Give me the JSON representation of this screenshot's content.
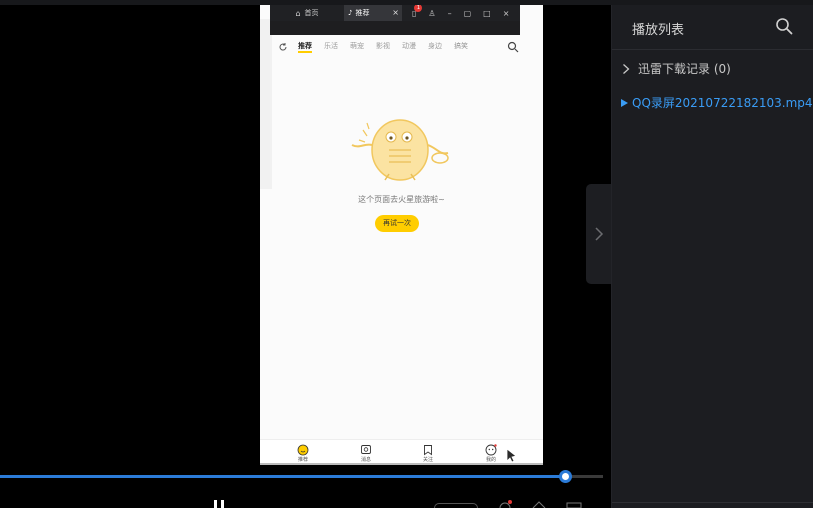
{
  "recording": {
    "browser_tabs": [
      {
        "label": "首页"
      },
      {
        "label": "推荐"
      }
    ],
    "tab_badge_count": "1",
    "nav_items": [
      "推荐",
      "乐活",
      "萌宠",
      "影视",
      "动漫",
      "身边",
      "搞笑"
    ],
    "empty_message": "这个页面去火星旅游啦~",
    "retry_label": "再试一次",
    "bottom_nav": [
      "推荐",
      "消息",
      "关注",
      "我的"
    ]
  },
  "progress": {
    "fraction": 0.937
  },
  "playlist": {
    "title": "播放列表",
    "folder_label": "迅雷下载记录 (0)",
    "playing_file": "QQ录屏20210722182103.mp4"
  },
  "colors": {
    "accent_blue": "#2b7bd8",
    "playing_text": "#3a9cf5",
    "yellow": "#ffcd00",
    "panel_bg": "#1c1d21"
  }
}
